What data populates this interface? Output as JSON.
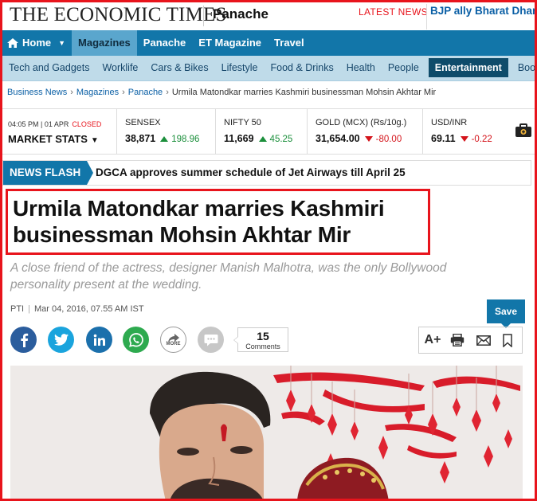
{
  "masthead": {
    "logo": "THE ECONOMIC TIMES",
    "section": "Panache",
    "latest_label": "LATEST NEWS",
    "latest_text": "BJP ally Bharat Dharma Jana Sena against Rahul in Wayanad"
  },
  "nav_primary": {
    "home": "Home",
    "magazines": "Magazines",
    "panache": "Panache",
    "et_magazine": "ET Magazine",
    "travel": "Travel"
  },
  "nav_secondary": {
    "items": [
      "Tech and Gadgets",
      "Worklife",
      "Cars & Bikes",
      "Lifestyle",
      "Food & Drinks",
      "Health",
      "People",
      "Entertainment",
      "Books"
    ],
    "active": "Entertainment"
  },
  "breadcrumb": {
    "items": [
      "Business News",
      "Magazines",
      "Panache"
    ],
    "current": "Urmila Matondkar marries Kashmiri businessman Mohsin Akhtar Mir"
  },
  "market": {
    "time": "04:05 PM | 01 APR",
    "status": "CLOSED",
    "title": "MARKET STATS",
    "indices": [
      {
        "name": "SENSEX",
        "value": "38,871",
        "change": "198.96",
        "direction": "up"
      },
      {
        "name": "NIFTY 50",
        "value": "11,669",
        "change": "45.25",
        "direction": "up"
      },
      {
        "name": "GOLD (MCX) (Rs/10g.)",
        "value": "31,654.00",
        "change": "-80.00",
        "direction": "down"
      },
      {
        "name": "USD/INR",
        "value": "69.11",
        "change": "-0.22",
        "direction": "down"
      }
    ]
  },
  "news_flash": {
    "label": "NEWS FLASH",
    "text": "DGCA approves summer schedule of Jet Airways till April 25"
  },
  "article": {
    "headline_line1": "Urmila Matondkar marries Kashmiri",
    "headline_line2": "businessman Mohsin Akhtar Mir",
    "synopsis_line1": "A close friend of the actress, designer Manish Malhotra, was the only Bollywood",
    "synopsis_line2": "personality present at the wedding.",
    "source": "PTI",
    "date": "Mar 04, 2016, 07.55 AM IST"
  },
  "share": {
    "more_label": "MORE",
    "comments_count": "15",
    "comments_label": "Comments"
  },
  "tools": {
    "save_label": "Save",
    "font_label": "A+"
  },
  "colors": {
    "accent_blue": "#1276a9",
    "highlight_red": "#e8141c",
    "positive": "#1b8f3b",
    "negative": "#d4141b"
  }
}
